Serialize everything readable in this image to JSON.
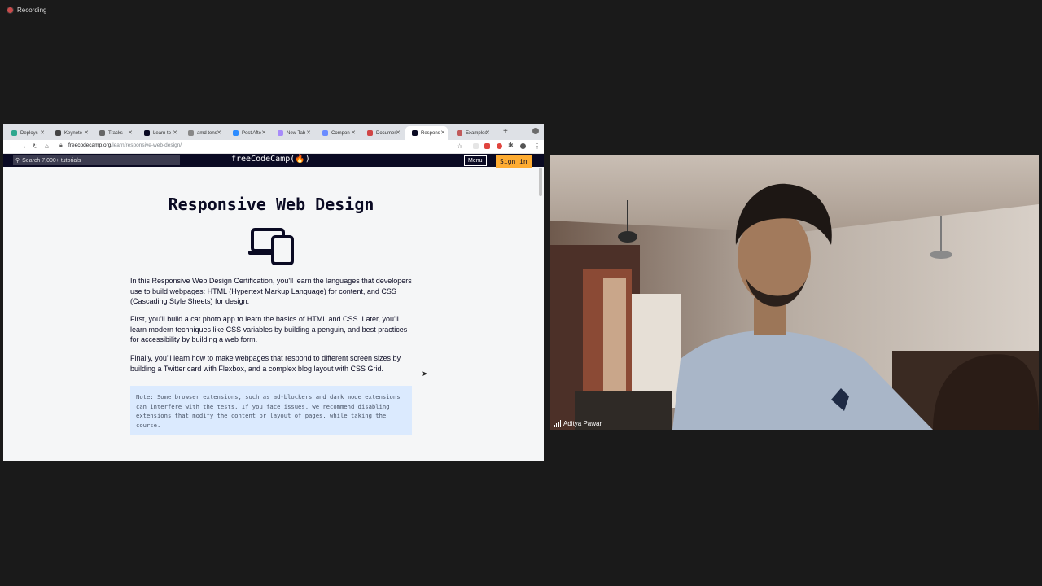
{
  "recording": {
    "label": "Recording"
  },
  "browser": {
    "tabs": [
      {
        "label": "Deploys",
        "color": "#2ea88f"
      },
      {
        "label": "Keynote",
        "color": "#444444"
      },
      {
        "label": "Tracks",
        "color": "#666666"
      },
      {
        "label": "Learn to",
        "color": "#0a0a23"
      },
      {
        "label": "amd tens",
        "color": "#888888"
      },
      {
        "label": "Post Afte",
        "color": "#2d8cff"
      },
      {
        "label": "New Tab",
        "color": "#a78bfa"
      },
      {
        "label": "Compon",
        "color": "#6b8cff"
      },
      {
        "label": "Documen",
        "color": "#d04545"
      },
      {
        "label": "Respons",
        "color": "#0a0a23"
      },
      {
        "label": "Examples",
        "color": "#c05a5a"
      }
    ],
    "url_host": "freecodecamp.org",
    "url_path": "/learn/responsive-web-design/"
  },
  "fcc": {
    "search_placeholder": "Search 7,000+ tutorials",
    "logo": "freeCodeCamp(🔥)",
    "menu_label": "Menu",
    "signin_label": "Sign in",
    "title": "Responsive Web Design",
    "paragraphs": [
      "In this Responsive Web Design Certification, you'll learn the languages that developers use to build webpages: HTML (Hypertext Markup Language) for content, and CSS (Cascading Style Sheets) for design.",
      "First, you'll build a cat photo app to learn the basics of HTML and CSS. Later, you'll learn modern techniques like CSS variables by building a penguin, and best practices for accessibility by building a web form.",
      "Finally, you'll learn how to make webpages that respond to different screen sizes by building a Twitter card with Flexbox, and a complex blog layout with CSS Grid."
    ],
    "note": "Note: Some browser extensions, such as ad-blockers and dark mode extensions can interfere with the tests. If you face issues, we recommend disabling extensions that modify the content or layout of pages, while taking the course."
  },
  "video": {
    "participant_name": "Aditya Pawar"
  }
}
